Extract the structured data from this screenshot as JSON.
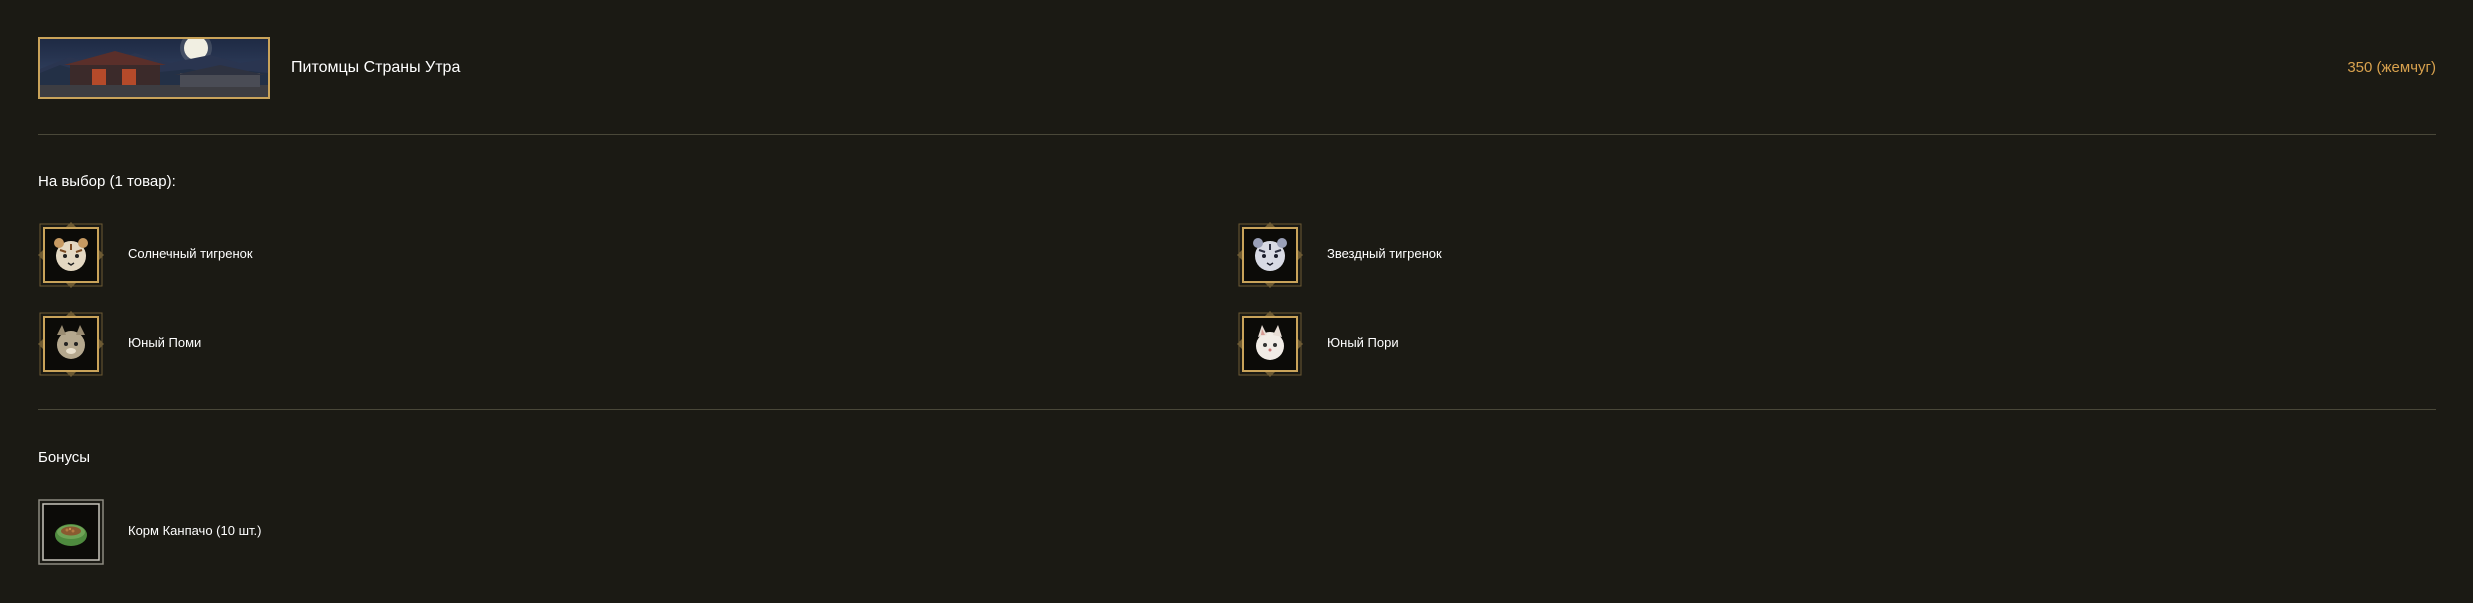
{
  "package": {
    "title": "Питомцы Страны Утра",
    "price": "350 (жемчуг)"
  },
  "choice": {
    "heading": "На выбор (1 товар):",
    "items": [
      {
        "label": "Солнечный тигренок",
        "icon": "sun-tiger-cub-icon"
      },
      {
        "label": "Звездный тигренок",
        "icon": "star-tiger-cub-icon"
      },
      {
        "label": "Юный Поми",
        "icon": "young-pomi-icon"
      },
      {
        "label": "Юный Пори",
        "icon": "young-pori-icon"
      }
    ]
  },
  "bonuses": {
    "heading": "Бонусы",
    "items": [
      {
        "label": "Корм Канпачо (10 шт.)",
        "icon": "kanpacho-food-bowl-icon"
      }
    ]
  },
  "colors": {
    "background": "#1b1a14",
    "accent_gold": "#c9a35a",
    "price": "#d9a24e",
    "divider": "#4a4839"
  }
}
